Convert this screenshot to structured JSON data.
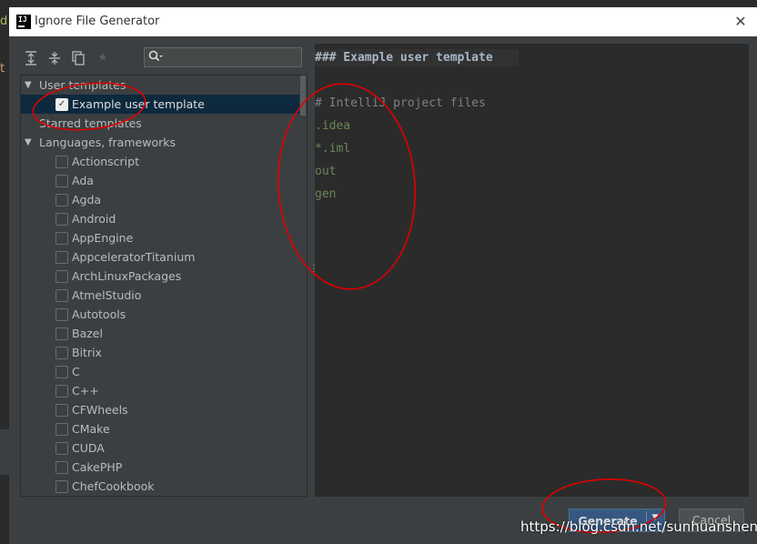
{
  "dialog": {
    "title": "Ignore File Generator",
    "close": "✕"
  },
  "toolbar": {
    "expand_icon": "expand-all-icon",
    "collapse_icon": "collapse-all-icon",
    "copy_icon": "copy-icon",
    "star_icon": "star-icon"
  },
  "search": {
    "value": "",
    "icon": "search-icon"
  },
  "tree": {
    "groups": [
      {
        "label": "User templates",
        "expanded": true
      },
      {
        "label": "Starred templates",
        "expanded": false
      },
      {
        "label": "Languages, frameworks",
        "expanded": true
      }
    ],
    "user_items": [
      {
        "label": "Example user template",
        "checked": true
      }
    ],
    "languages": [
      "Actionscript",
      "Ada",
      "Agda",
      "Android",
      "AppEngine",
      "AppceleratorTitanium",
      "ArchLinuxPackages",
      "AtmelStudio",
      "Autotools",
      "Bazel",
      "Bitrix",
      "C",
      "C++",
      "CFWheels",
      "CMake",
      "CUDA",
      "CakePHP",
      "ChefCookbook"
    ]
  },
  "editor": {
    "header": "### Example user template",
    "comment": "# IntelliJ project files",
    "patterns": [
      ".idea",
      "*.iml",
      "out",
      "gen"
    ]
  },
  "buttons": {
    "generate": "Generate",
    "cancel": "Cancel"
  },
  "background_code": {
    "g1": "d",
    "g2": "t"
  },
  "watermark": "https://blog.csdn.net/sunhuansheng",
  "colors": {
    "annotation": "#e00000",
    "selection": "#0d293e",
    "primary_button": "#365880"
  }
}
